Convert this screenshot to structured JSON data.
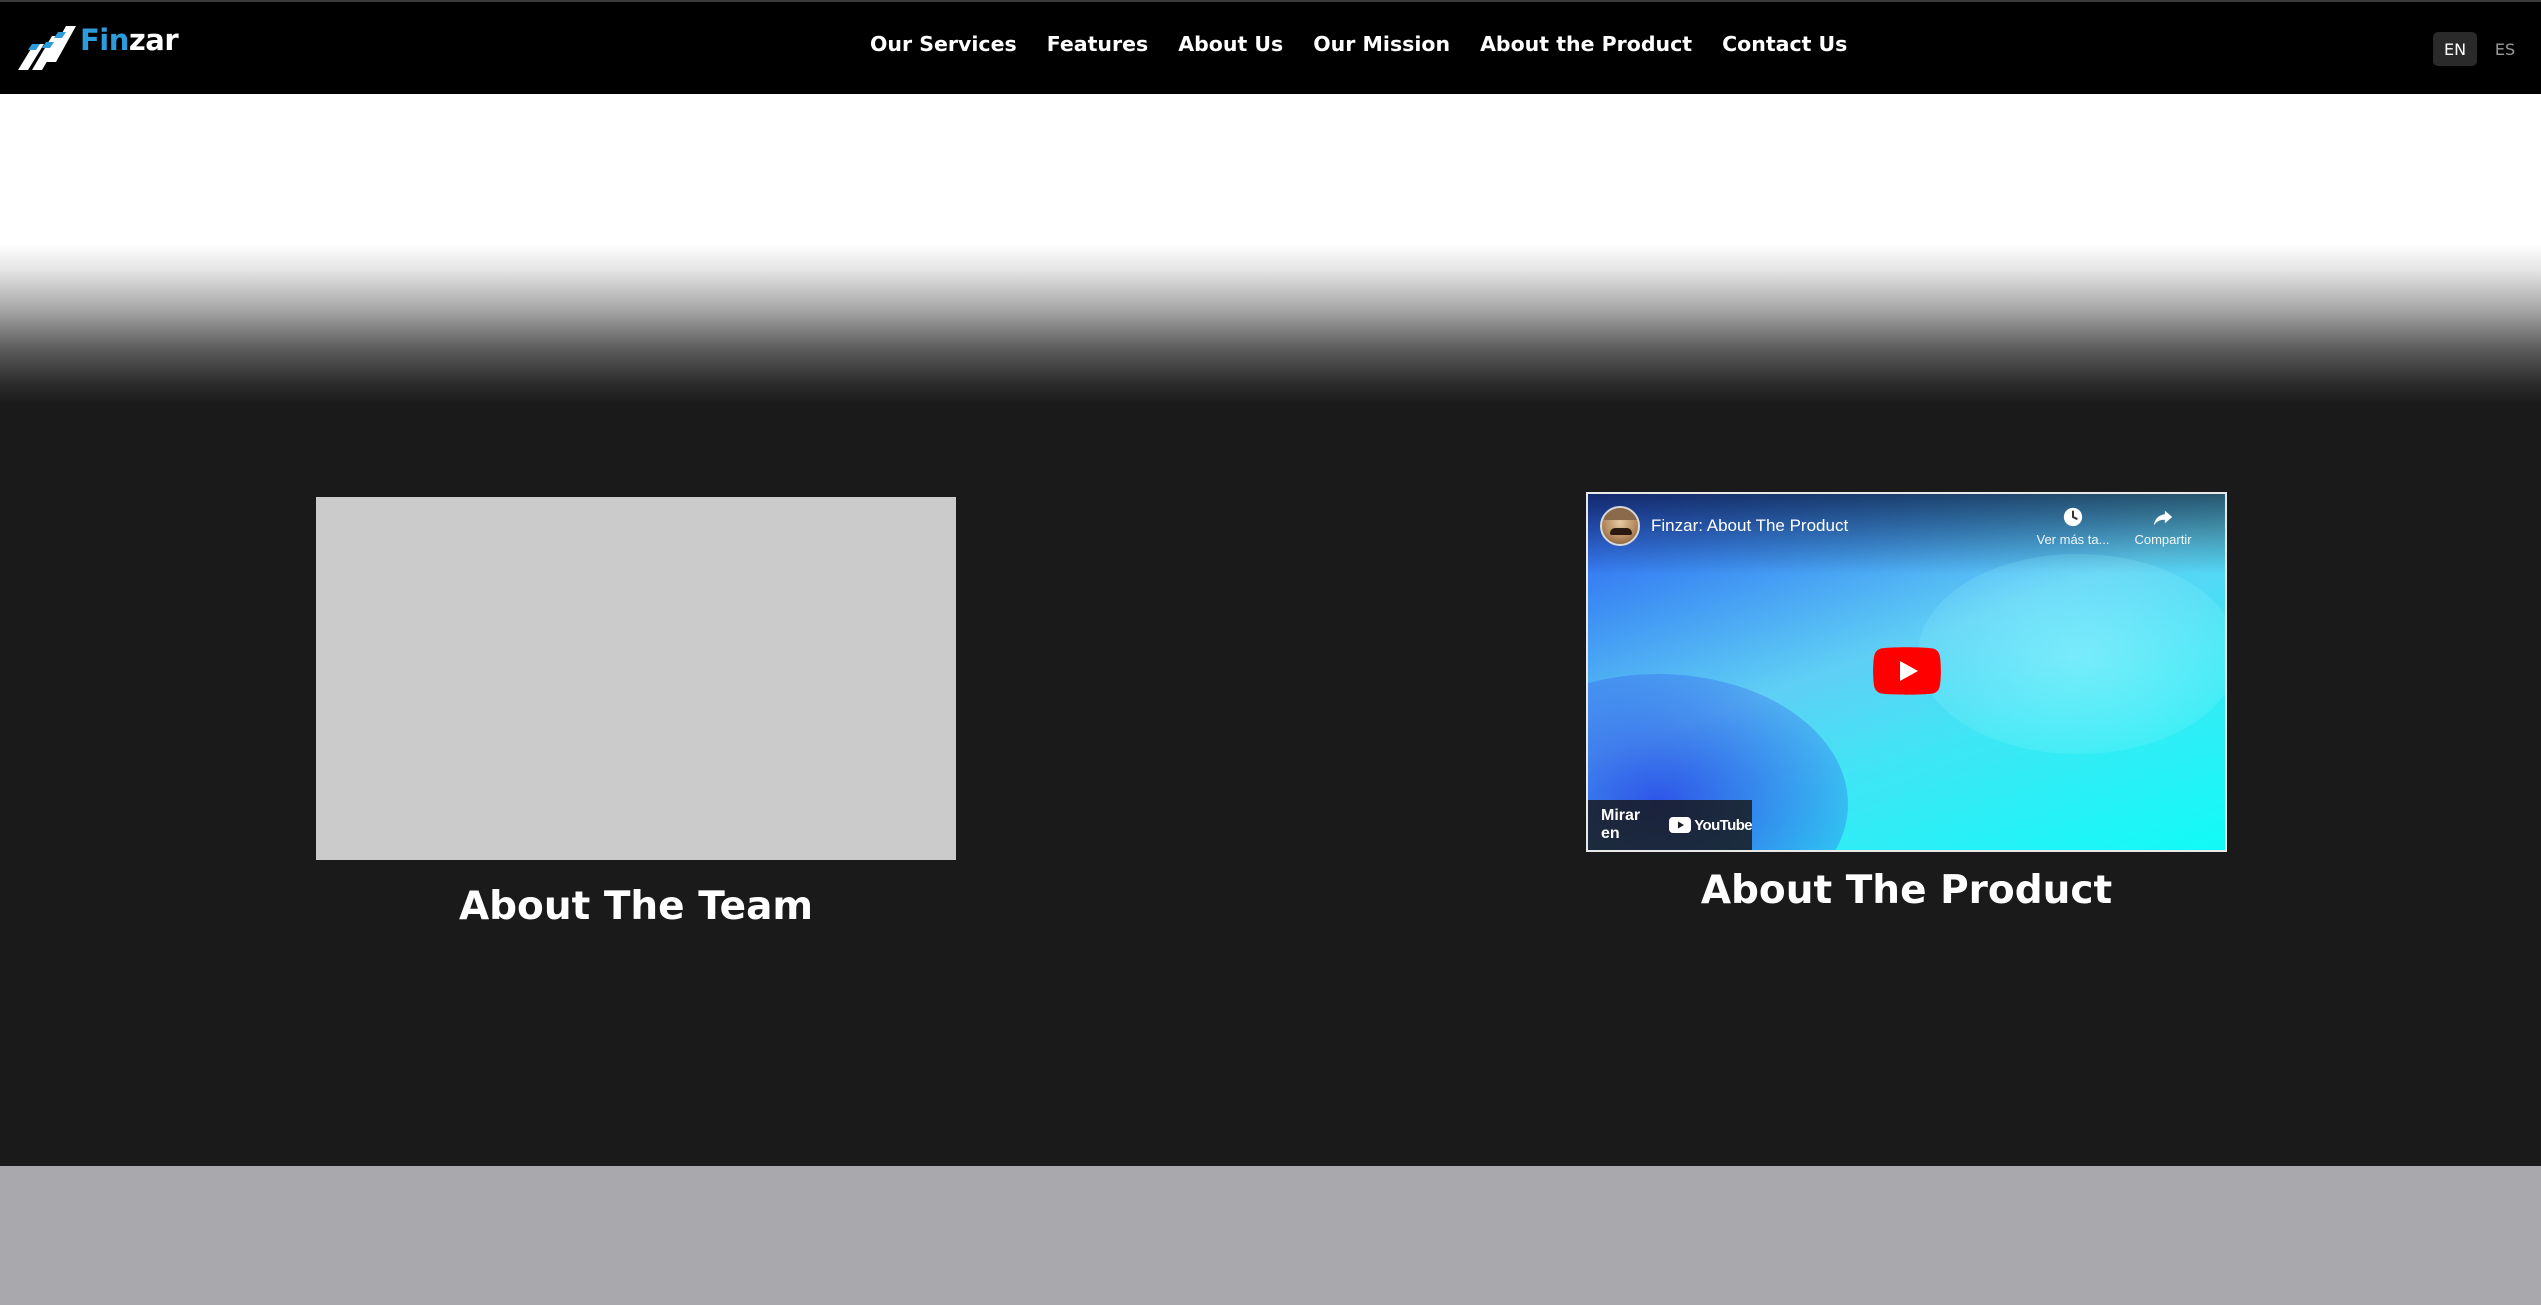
{
  "header": {
    "logo": {
      "part1": "Fin",
      "part2": "zar"
    },
    "nav": [
      {
        "label": "Our Services"
      },
      {
        "label": "Features"
      },
      {
        "label": "About Us"
      },
      {
        "label": "Our Mission"
      },
      {
        "label": "About the Product"
      },
      {
        "label": "Contact Us"
      }
    ],
    "languages": [
      {
        "code": "EN",
        "active": true
      },
      {
        "code": "ES",
        "active": false
      }
    ]
  },
  "team": {
    "title": "About The Team"
  },
  "product": {
    "title": "About The Product",
    "video": {
      "title": "Finzar: About The Product",
      "watch_later_label": "Ver más ta...",
      "share_label": "Compartir",
      "watch_on_label": "Mirar en",
      "platform": "YouTube"
    }
  },
  "colors": {
    "header_bg": "#000000",
    "logo_accent": "#2d9cdb",
    "content_bg": "#1a1a1a",
    "image_placeholder": "#cbcbcb",
    "footer_band": "#a9a8ad",
    "play_red": "#ff0000"
  }
}
